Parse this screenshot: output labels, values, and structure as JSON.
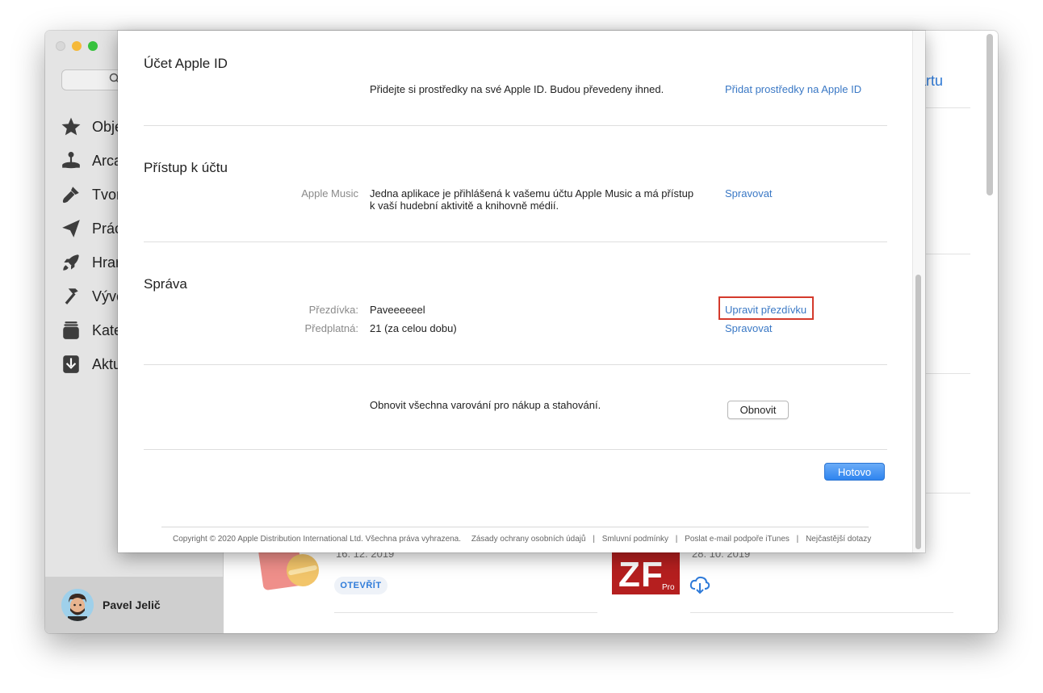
{
  "window": {
    "sidebar": {
      "search": {
        "placeholder": ""
      },
      "items": [
        {
          "label": "Obje",
          "icon": "star-icon"
        },
        {
          "label": "Arca",
          "icon": "joystick-icon"
        },
        {
          "label": "Tvor",
          "icon": "brush-icon"
        },
        {
          "label": "Prác",
          "icon": "paper-plane-icon"
        },
        {
          "label": "Hrar",
          "icon": "rocket-icon"
        },
        {
          "label": "Vývo",
          "icon": "hammer-icon"
        },
        {
          "label": "Kate",
          "icon": "stack-icon"
        },
        {
          "label": "Aktu",
          "icon": "download-icon"
        }
      ],
      "profile": {
        "name": "Pavel Jelič"
      }
    },
    "background": {
      "header_link": "artu",
      "date_left": "16. 12. 2019",
      "date_right": "28. 10. 2019",
      "open_button": "OTEVŘÍT"
    }
  },
  "sheet": {
    "apple_id": {
      "title": "Účet Apple ID",
      "text": "Přidejte si prostředky na své Apple ID. Budou převedeny ihned.",
      "link": "Přidat prostředky na Apple ID"
    },
    "access": {
      "title": "Přístup k účtu",
      "label": "Apple Music",
      "text_line1": "Jedna aplikace je přihlášená k vašemu účtu Apple Music a má přístup",
      "text_line2": "k vaší hudební aktivitě a knihovně médií.",
      "link": "Spravovat"
    },
    "management": {
      "title": "Správa",
      "nickname_label": "Přezdívka:",
      "nickname_value": "Paveeeeeel",
      "nickname_link": "Upravit přezdívku",
      "subscriptions_label": "Předplatná:",
      "subscriptions_value": "21 (za celou dobu)",
      "subscriptions_link": "Spravovat"
    },
    "warnings": {
      "text": "Obnovit všechna varování pro nákup a stahování.",
      "button": "Obnovit"
    },
    "done_button": "Hotovo",
    "footer": {
      "copyright": "Copyright © 2020 Apple Distribution International Ltd. Všechna práva vyhrazena.",
      "links": [
        "Zásady ochrany osobních údajů",
        "Smluvní podmínky",
        "Poslat e-mail podpoře iTunes",
        "Nejčastější dotazy"
      ]
    }
  },
  "colors": {
    "link": "#3a78c5",
    "highlight": "#d43a2c",
    "primary_button": "#2e84ef"
  }
}
